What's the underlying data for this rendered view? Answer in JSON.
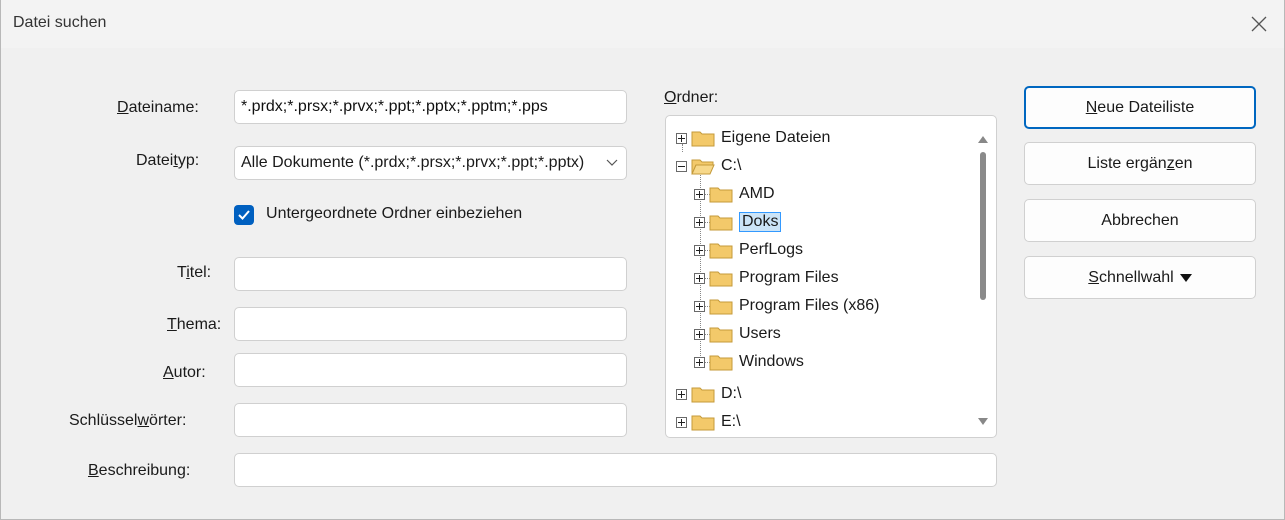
{
  "dialog": {
    "title": "Datei suchen"
  },
  "form": {
    "dateiname": {
      "label_pre": "",
      "label_u": "D",
      "label_post": "ateiname:",
      "value": "*.prdx;*.prsx;*.prvx;*.ppt;*.pptx;*.pptm;*.pps"
    },
    "dateityp": {
      "label_pre": "Datei",
      "label_u": "t",
      "label_post": "yp:",
      "value": "Alle Dokumente (*.prdx;*.prsx;*.prvx;*.ppt;*.pptx)"
    },
    "subfolders": {
      "label_u": "U",
      "label_post": "ntergeordnete Ordner einbeziehen",
      "checked": true
    },
    "titel": {
      "label_pre": "T",
      "label_u": "i",
      "label_post": "tel:",
      "value": ""
    },
    "thema": {
      "label_pre": "",
      "label_u": "T",
      "label_post": "hema:",
      "value": ""
    },
    "autor": {
      "label_pre": "",
      "label_u": "A",
      "label_post": "utor:",
      "value": ""
    },
    "schluesselwoerter": {
      "label_pre": "Schlüssel",
      "label_u": "w",
      "label_post": "örter:",
      "value": ""
    },
    "beschreibung": {
      "label_pre": "",
      "label_u": "B",
      "label_post": "eschreibung:",
      "value": ""
    }
  },
  "ordner": {
    "label_u": "O",
    "label_post": "rdner:",
    "items": [
      {
        "label": "Eigene Dateien"
      },
      {
        "label": "C:\\"
      },
      {
        "label": "AMD"
      },
      {
        "label": "Doks"
      },
      {
        "label": "PerfLogs"
      },
      {
        "label": "Program Files"
      },
      {
        "label": "Program Files (x86)"
      },
      {
        "label": "Users"
      },
      {
        "label": "Windows"
      },
      {
        "label": "D:\\"
      },
      {
        "label": "E:\\"
      }
    ],
    "selected": "Doks"
  },
  "buttons": {
    "neue": {
      "pre": "",
      "u": "N",
      "post": "eue Dateiliste"
    },
    "ergaenzen": {
      "pre": "Liste ergän",
      "u": "z",
      "post": "en"
    },
    "abbrechen": {
      "pre": "Abbrechen",
      "u": "",
      "post": ""
    },
    "schnellwahl": {
      "pre": "",
      "u": "S",
      "post": "chnellwahl"
    }
  },
  "colors": {
    "accent": "#0067c0",
    "selection_bg": "#cce4f7",
    "selection_border": "#3399ff",
    "folder": "#f3c96a"
  }
}
